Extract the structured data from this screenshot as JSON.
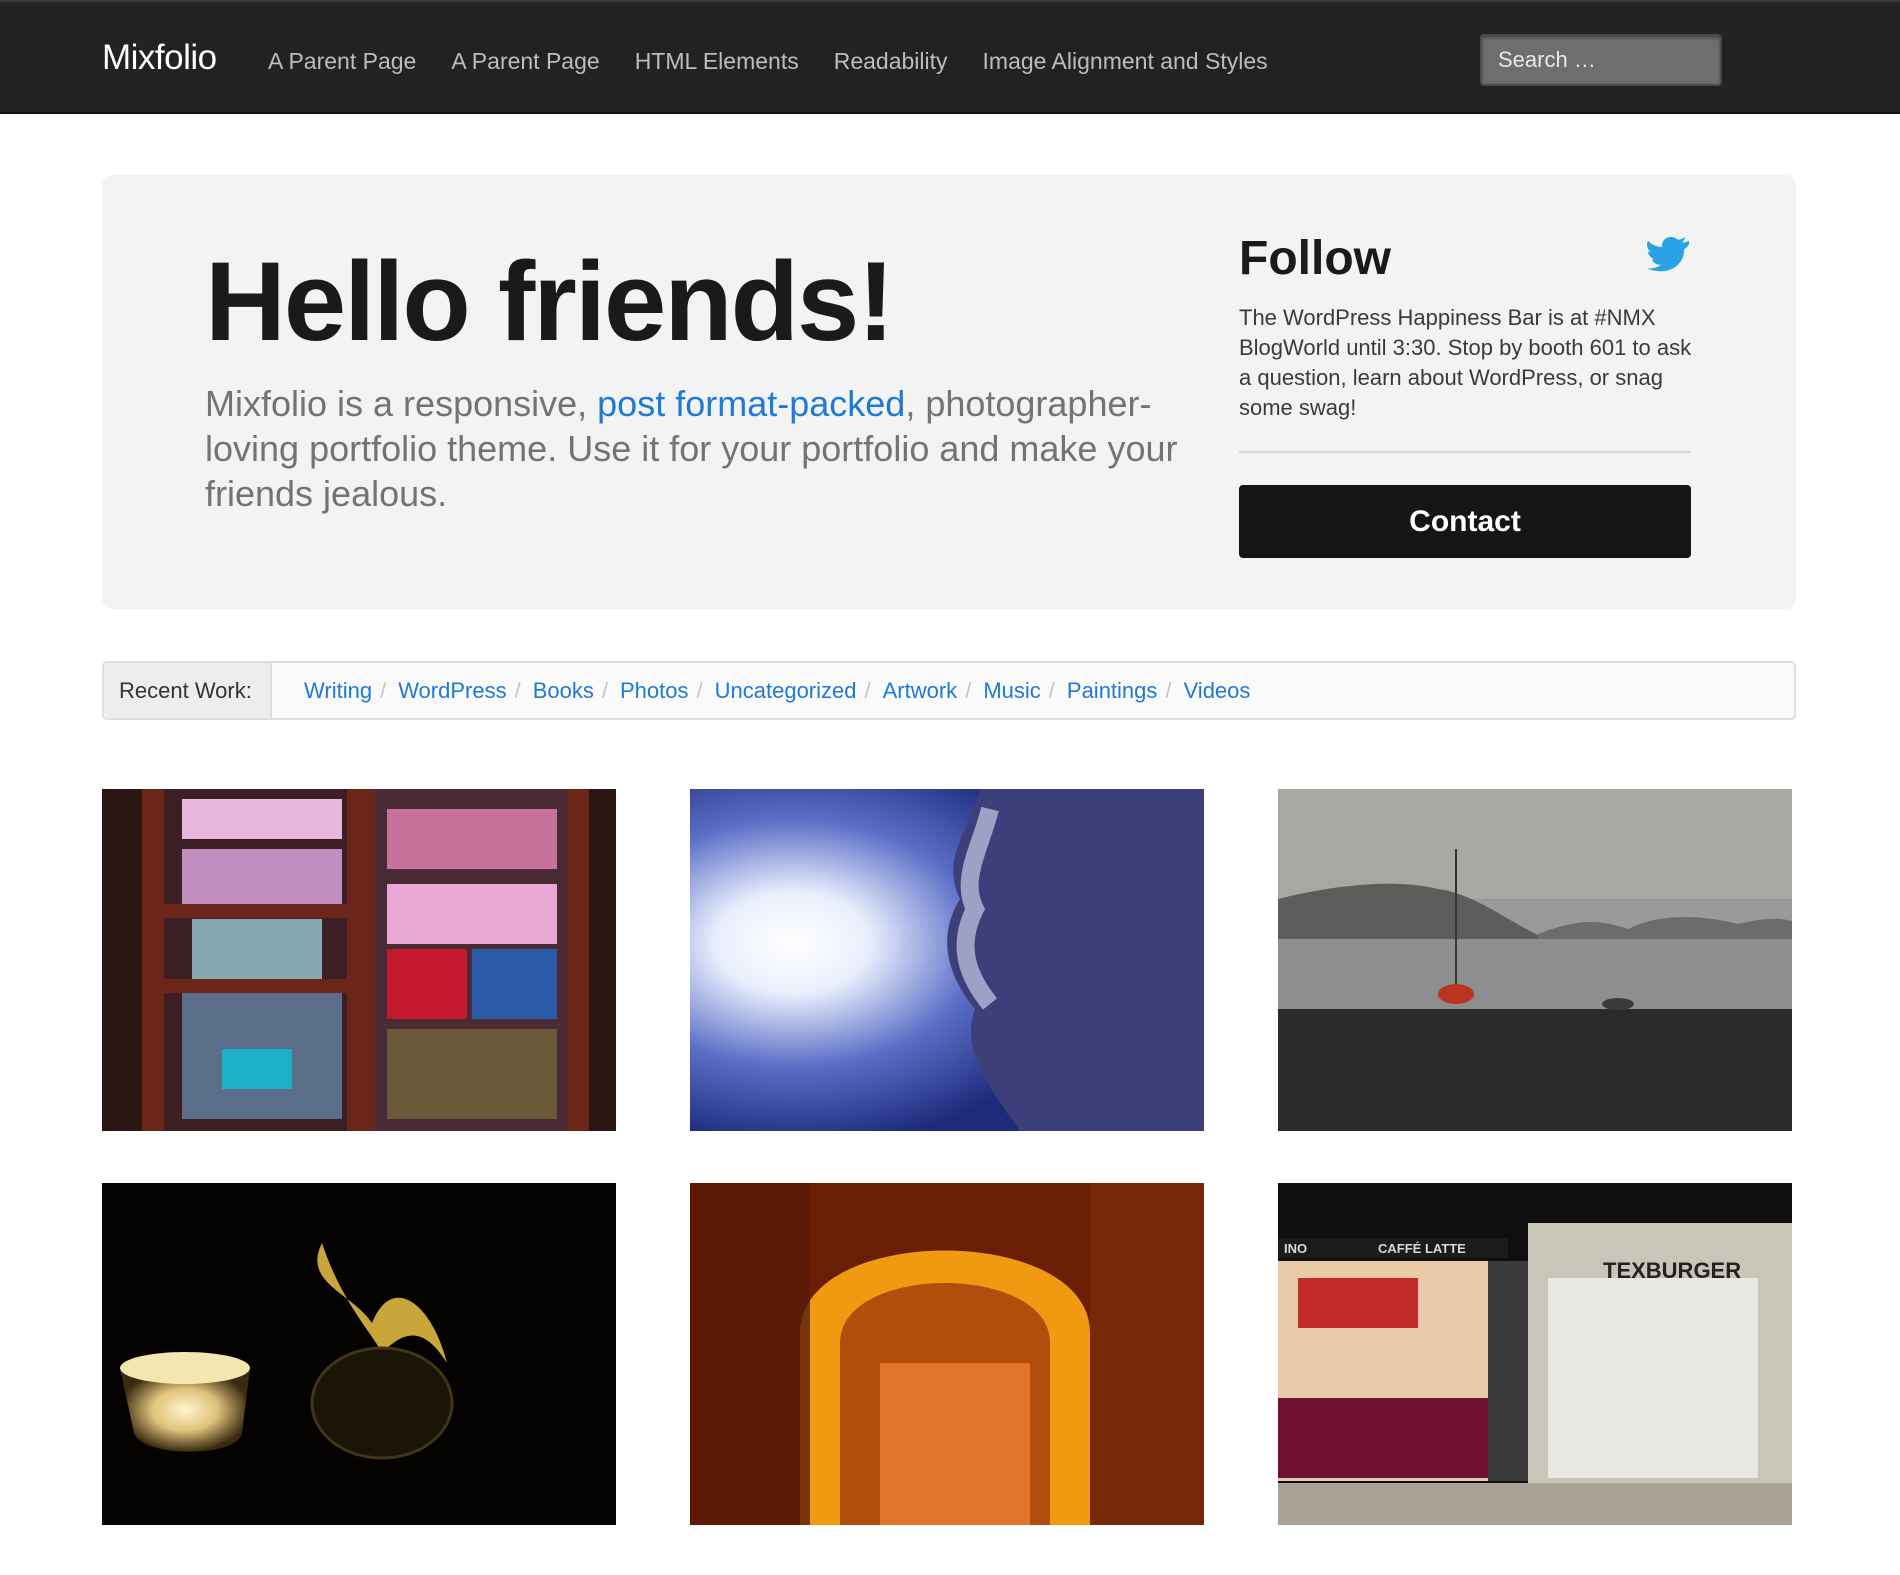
{
  "navbar": {
    "brand": "Mixfolio",
    "links": [
      "A Parent Page",
      "A Parent Page",
      "HTML Elements",
      "Readability",
      "Image Alignment and Styles"
    ],
    "search_placeholder": "Search …"
  },
  "hero": {
    "title": "Hello friends!",
    "text_before": "Mixfolio is a responsive, ",
    "text_link": "post format-packed",
    "text_after": ", photographer-loving portfolio theme. Use it for your portfolio and make your friends jealous.",
    "follow_title": "Follow",
    "tweet": "The WordPress Happiness Bar is at #NMX BlogWorld until 3:30. Stop by booth 601 to ask a question, learn about WordPress, or snag some swag!",
    "contact_label": "Contact"
  },
  "recent_work": {
    "label": "Recent Work:",
    "categories": [
      "Writing",
      "WordPress",
      "Books",
      "Photos",
      "Uncategorized",
      "Artwork",
      "Music",
      "Paintings",
      "Videos"
    ],
    "separator": "/"
  },
  "gallery": {
    "signs": {
      "cafe": "CAFFÉ LATTE",
      "cafe_left": "INO",
      "burger": "TEXBURGER"
    }
  },
  "colors": {
    "navbar_bg": "#222222",
    "link_blue": "#1f7ad6",
    "hero_bg": "#f3f3f3",
    "contact_bg": "#151515",
    "twitter_blue": "#2aa3e6"
  },
  "icons": {
    "twitter": "twitter-bird-icon"
  }
}
